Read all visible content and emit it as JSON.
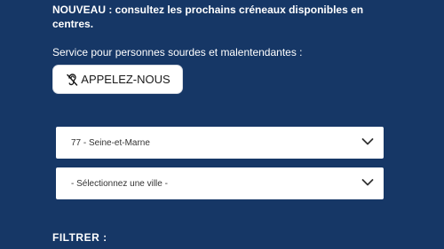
{
  "notice": {
    "text": "NOUVEAU : consultez les prochains créneaux disponibles en centres."
  },
  "service": {
    "text": "Service pour personnes sourdes et malentendantes :"
  },
  "call_button": {
    "label": "APPELEZ-NOUS",
    "icon": "hearing-impaired-icon"
  },
  "department_select": {
    "selected": "77 - Seine-et-Marne",
    "icon": "chevron-down-icon"
  },
  "city_select": {
    "selected": "- Sélectionnez une ville -",
    "icon": "chevron-down-icon"
  },
  "filter": {
    "label": "FILTRER :"
  },
  "colors": {
    "background": "#163766",
    "text": "#ffffff",
    "button_bg": "#ffffff",
    "select_text": "#333333"
  }
}
